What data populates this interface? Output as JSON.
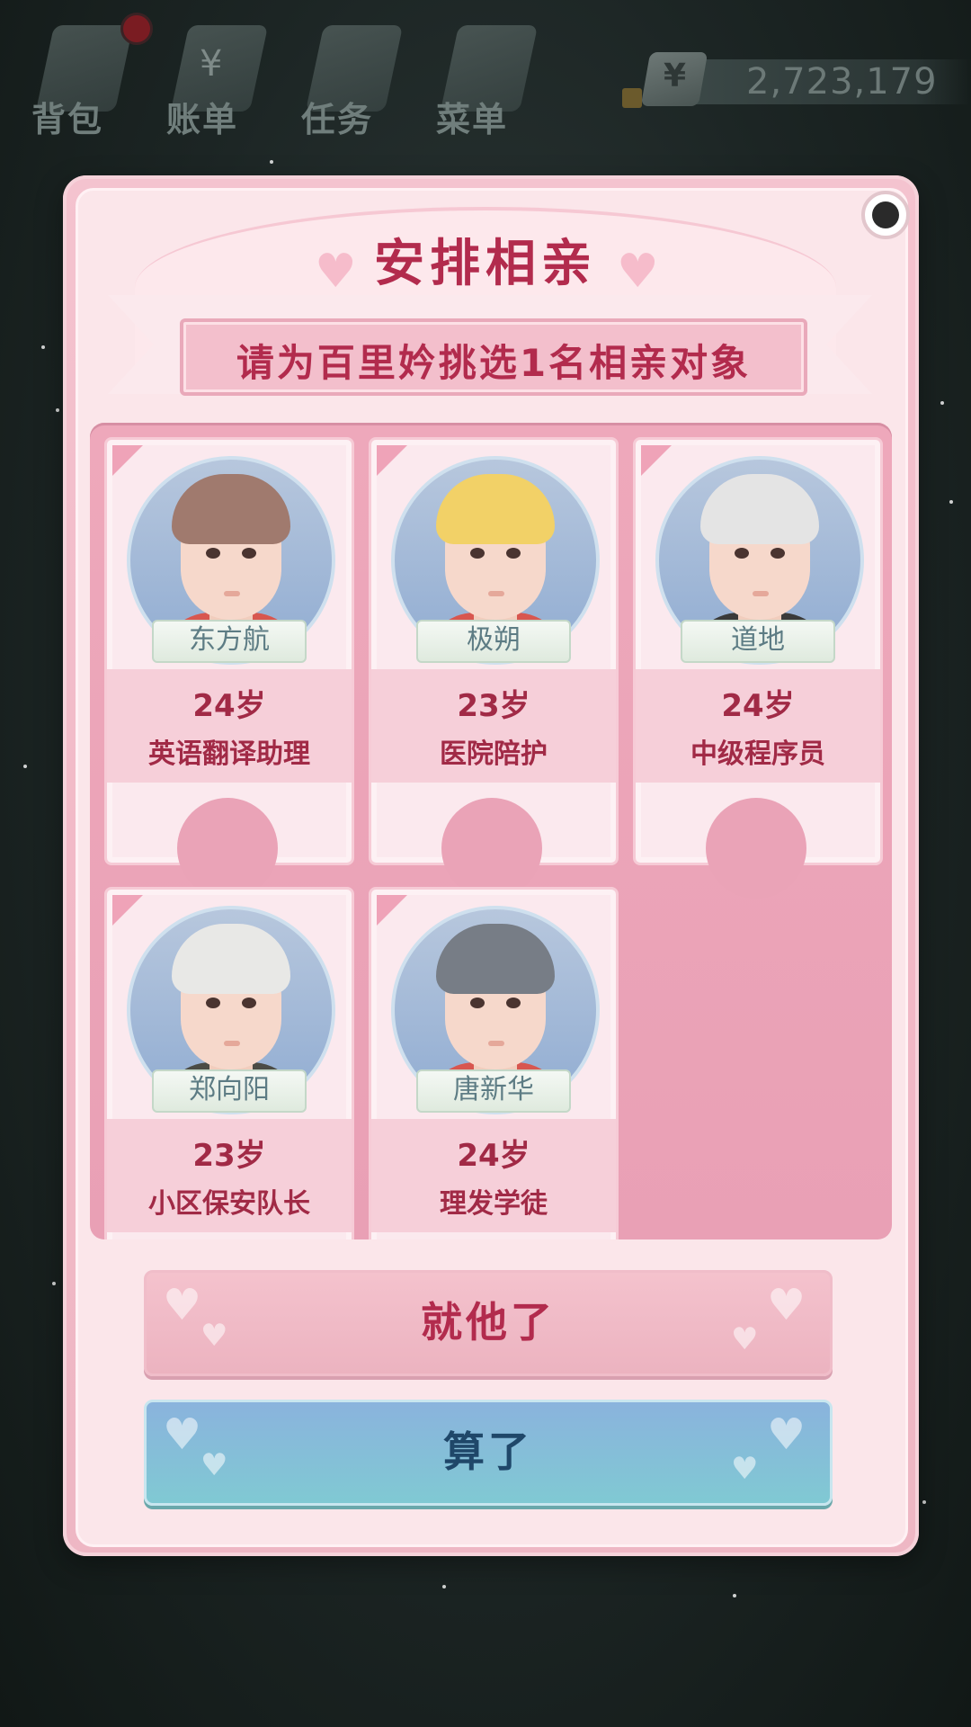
{
  "topbar": {
    "items": [
      {
        "label": "背包",
        "icon": "backpack-icon"
      },
      {
        "label": "账单",
        "icon": "bill-icon"
      },
      {
        "label": "任务",
        "icon": "task-icon"
      },
      {
        "label": "菜单",
        "icon": "menu-icon"
      }
    ],
    "money": {
      "currency_symbol": "¥",
      "value": "2,723,179"
    }
  },
  "dialog": {
    "title": "安排相亲",
    "subtitle": "请为百里妗挑选1名相亲对象",
    "candidates": [
      {
        "name": "东方航",
        "age": "24岁",
        "job": "英语翻译助理",
        "hair_color": "#a07a6e",
        "shirt_color": "#d8564f"
      },
      {
        "name": "极朔",
        "age": "23岁",
        "job": "医院陪护",
        "hair_color": "#f2d167",
        "shirt_color": "#d8564f"
      },
      {
        "name": "道地",
        "age": "24岁",
        "job": "中级程序员",
        "hair_color": "#e4e4e4",
        "shirt_color": "#3a3a3a"
      },
      {
        "name": "郑向阳",
        "age": "23岁",
        "job": "小区保安队长",
        "hair_color": "#e8e8e6",
        "shirt_color": "#4b4b45"
      },
      {
        "name": "唐新华",
        "age": "24岁",
        "job": "理发学徒",
        "hair_color": "#777d86",
        "shirt_color": "#d8564f"
      }
    ],
    "confirm_label": "就他了",
    "cancel_label": "算了"
  },
  "colors": {
    "accent": "#b22b4d",
    "panel_pink": "#eea8bb",
    "cancel_blue": "#8ab3dd"
  }
}
